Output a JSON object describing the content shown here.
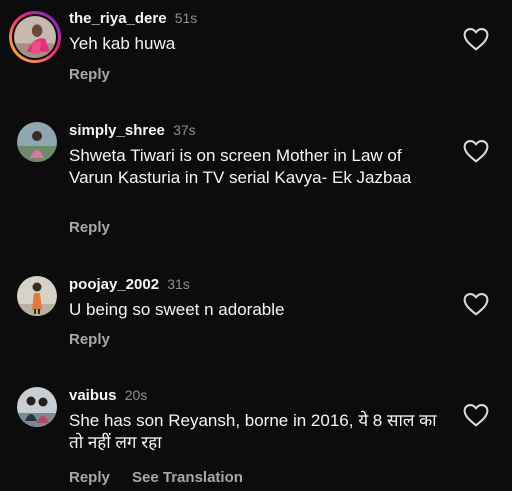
{
  "comments": [
    {
      "username": "the_riya_dere",
      "time": "51s",
      "text": "Yeh kab huwa",
      "reply": "Reply",
      "avatar_icon": "avatar-pink-outfit",
      "has_story": true
    },
    {
      "username": "simply_shree",
      "time": "37s",
      "text": "Shweta Tiwari is on screen Mother in Law of Varun Kasturia in TV serial Kavya- Ek Jazbaa",
      "reply": "Reply",
      "avatar_icon": "avatar-person-outdoor",
      "has_story": false
    },
    {
      "username": "poojay_2002",
      "time": "31s",
      "text": "U being so sweet n adorable",
      "reply": "Reply",
      "avatar_icon": "avatar-person-standing",
      "has_story": false
    },
    {
      "username": "vaibus",
      "time": "20s",
      "text": "She has son Reyansh, borne in 2016,  ये 8 साल का तो नहीं लग रहा",
      "reply": "Reply",
      "see_translation": "See Translation",
      "avatar_icon": "avatar-two-people",
      "has_story": false
    }
  ],
  "like_icon": "heart-outline-icon",
  "colors": {
    "background": "#0c0c0c",
    "text": "#f5f5f5",
    "secondary": "#a8a8a8",
    "timestamp": "#8e8e8e"
  }
}
